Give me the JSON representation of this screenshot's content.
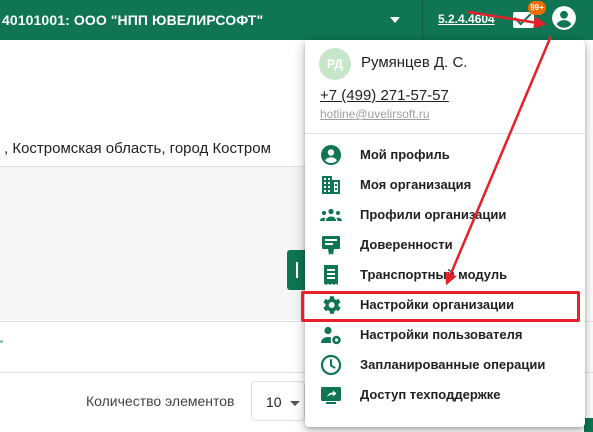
{
  "topbar": {
    "org_label": "40101001: ООО \"НПП ЮВЕЛИРСОФТ\"",
    "version": "5.2.4.4604",
    "mail_badge": "99+",
    "mail_icon": "mail-icon",
    "account_icon": "account-circle-icon"
  },
  "page": {
    "address": ", Костромская область, город Костром",
    "count_label": "Количество элементов",
    "count_value": "10"
  },
  "user_menu": {
    "avatar_initials": "РД",
    "name": "Румянцев Д. С.",
    "phone": "+7 (499) 271-57-57",
    "email": "hotline@uvelirsoft.ru",
    "items": [
      {
        "label": "Мой профиль",
        "icon": "account-circle-icon"
      },
      {
        "label": "Моя организация",
        "icon": "building-icon"
      },
      {
        "label": "Профили организации",
        "icon": "people-group-icon"
      },
      {
        "label": "Доверенности",
        "icon": "certificate-icon"
      },
      {
        "label": "Транспортный модуль",
        "icon": "document-list-icon"
      },
      {
        "label": "Настройки организации",
        "icon": "gear-icon"
      },
      {
        "label": "Настройки пользователя",
        "icon": "user-settings-icon"
      },
      {
        "label": "Запланированные операции",
        "icon": "clock-icon"
      },
      {
        "label": "Доступ техподдержке",
        "icon": "share-screen-icon"
      }
    ]
  },
  "colors": {
    "brand_green": "#0f7553",
    "highlight_red": "#e8202a",
    "badge_orange": "#ef6c00"
  }
}
